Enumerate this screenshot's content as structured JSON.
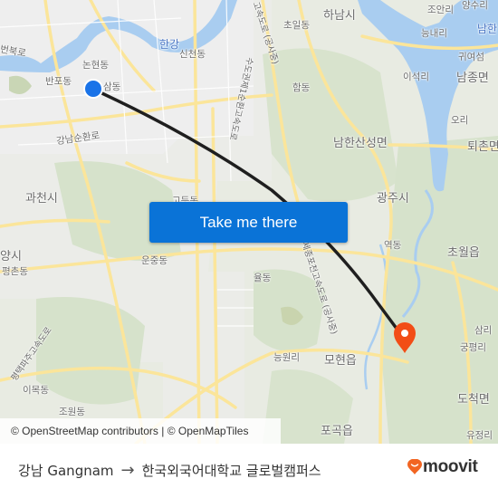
{
  "map": {
    "attribution": "© OpenStreetMap contributors | © OpenMapTiles",
    "action_button": "Take me there",
    "origin_marker_color": "#1a73e8",
    "destination_marker_color": "#f24d16",
    "route_line_color": "#1f1f1f",
    "labels": [
      {
        "text": "한강",
        "kind": "water"
      },
      {
        "text": "논현동"
      },
      {
        "text": "반포동"
      },
      {
        "text": "삼동"
      },
      {
        "text": "신천동"
      },
      {
        "text": "초일동"
      },
      {
        "text": "하남시",
        "kind": "big"
      },
      {
        "text": "함동"
      },
      {
        "text": "조안리"
      },
      {
        "text": "능내리"
      },
      {
        "text": "귀여섬"
      },
      {
        "text": "남종면",
        "kind": "big"
      },
      {
        "text": "이석리"
      },
      {
        "text": "오리"
      },
      {
        "text": "퇴촌면",
        "kind": "big"
      },
      {
        "text": "남한산성면",
        "kind": "big"
      },
      {
        "text": "강남순환로"
      },
      {
        "text": "과천시",
        "kind": "big"
      },
      {
        "text": "고등동"
      },
      {
        "text": "광주시",
        "kind": "big"
      },
      {
        "text": "역동"
      },
      {
        "text": "초월읍",
        "kind": "big"
      },
      {
        "text": "양시",
        "kind": "big"
      },
      {
        "text": "평촌동"
      },
      {
        "text": "운중동"
      },
      {
        "text": "율동"
      },
      {
        "text": "능원리"
      },
      {
        "text": "모현읍",
        "kind": "big"
      },
      {
        "text": "삼리"
      },
      {
        "text": "궁평리"
      },
      {
        "text": "도척면",
        "kind": "big"
      },
      {
        "text": "포곡읍",
        "kind": "big"
      },
      {
        "text": "유정리"
      },
      {
        "text": "이목동"
      },
      {
        "text": "조원동"
      },
      {
        "text": "남한",
        "kind": "water"
      },
      {
        "text": "양수리"
      },
      {
        "text": "번북로"
      }
    ],
    "road_labels": [
      {
        "text": "고속도로 (공사중)"
      },
      {
        "text": "수도권제1순환고속도로"
      },
      {
        "text": "세종포천고속도로 (공사중)"
      },
      {
        "text": "평택파주고속도로"
      }
    ]
  },
  "footer": {
    "origin": "강남 Gangnam",
    "arrow": "→",
    "destination": "한국외국어대학교 글로벌캠퍼스",
    "brand": "moovit",
    "brand_color": "#f26522"
  }
}
